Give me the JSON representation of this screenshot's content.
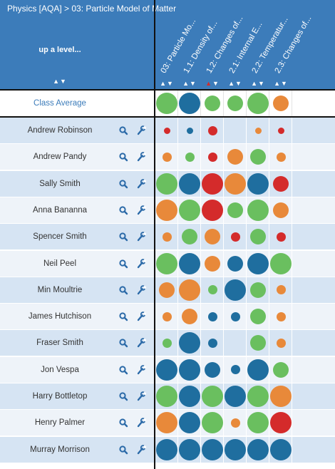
{
  "header": {
    "breadcrumb": "Physics [AQA] > 03: Particle Model of Matter",
    "up_level": "up a level...",
    "sort_icon": "▲▼"
  },
  "columns": [
    {
      "label": "03: Particle Mo...",
      "sort_active": false
    },
    {
      "label": "1.1: Density of...",
      "sort_active": false
    },
    {
      "label": "1.2: Changes of...",
      "sort_active": true
    },
    {
      "label": "2.1: Internal E...",
      "sort_active": false
    },
    {
      "label": "2.2: Temperatur...",
      "sort_active": false
    },
    {
      "label": "2.3: Changes of...",
      "sort_active": false
    }
  ],
  "colors": {
    "green": "#6abf5f",
    "blue": "#1f6e9f",
    "red": "#d42b2b",
    "orange": "#e8893a",
    "header_blue": "#3c7cba"
  },
  "icons": {
    "search": "search-icon",
    "wrench": "wrench-icon",
    "sort": "sort-arrows-icon"
  },
  "class_average": {
    "label": "Class Average",
    "cells": [
      {
        "color": "green",
        "size": 3
      },
      {
        "color": "blue",
        "size": 3
      },
      {
        "color": "green",
        "size": 2
      },
      {
        "color": "green",
        "size": 2
      },
      {
        "color": "green",
        "size": 3
      },
      {
        "color": "orange",
        "size": 2
      }
    ]
  },
  "students": [
    {
      "name": "Andrew Robinson",
      "cells": [
        {
          "color": "red",
          "size": 0
        },
        {
          "color": "blue",
          "size": 0
        },
        {
          "color": "red",
          "size": 1
        },
        null,
        {
          "color": "orange",
          "size": 0
        },
        {
          "color": "red",
          "size": 0
        }
      ]
    },
    {
      "name": "Andrew Pandy",
      "cells": [
        {
          "color": "orange",
          "size": 1
        },
        {
          "color": "green",
          "size": 1
        },
        {
          "color": "red",
          "size": 1
        },
        {
          "color": "orange",
          "size": 2
        },
        {
          "color": "green",
          "size": 2
        },
        {
          "color": "orange",
          "size": 1
        }
      ]
    },
    {
      "name": "Sally Smith",
      "cells": [
        {
          "color": "green",
          "size": 3
        },
        {
          "color": "blue",
          "size": 3
        },
        {
          "color": "red",
          "size": 3
        },
        {
          "color": "orange",
          "size": 3
        },
        {
          "color": "blue",
          "size": 3
        },
        {
          "color": "red",
          "size": 2
        }
      ]
    },
    {
      "name": "Anna Bananna",
      "cells": [
        {
          "color": "orange",
          "size": 3
        },
        {
          "color": "green",
          "size": 3
        },
        {
          "color": "red",
          "size": 3
        },
        {
          "color": "green",
          "size": 2
        },
        {
          "color": "green",
          "size": 3
        },
        {
          "color": "orange",
          "size": 2
        }
      ]
    },
    {
      "name": "Spencer Smith",
      "cells": [
        {
          "color": "orange",
          "size": 1
        },
        {
          "color": "green",
          "size": 2
        },
        {
          "color": "orange",
          "size": 2
        },
        {
          "color": "red",
          "size": 1
        },
        {
          "color": "green",
          "size": 2
        },
        {
          "color": "red",
          "size": 1
        }
      ]
    },
    {
      "name": "Neil Peel",
      "cells": [
        {
          "color": "green",
          "size": 3
        },
        {
          "color": "blue",
          "size": 3
        },
        {
          "color": "orange",
          "size": 2
        },
        {
          "color": "blue",
          "size": 2
        },
        {
          "color": "blue",
          "size": 3
        },
        {
          "color": "green",
          "size": 3
        }
      ]
    },
    {
      "name": "Min Moultrie",
      "cells": [
        {
          "color": "orange",
          "size": 2
        },
        {
          "color": "orange",
          "size": 3
        },
        {
          "color": "green",
          "size": 1
        },
        {
          "color": "blue",
          "size": 3
        },
        {
          "color": "green",
          "size": 2
        },
        {
          "color": "orange",
          "size": 1
        }
      ]
    },
    {
      "name": "James Hutchison",
      "cells": [
        {
          "color": "orange",
          "size": 1
        },
        {
          "color": "orange",
          "size": 2
        },
        {
          "color": "blue",
          "size": 1
        },
        {
          "color": "blue",
          "size": 1
        },
        {
          "color": "green",
          "size": 2
        },
        {
          "color": "orange",
          "size": 1
        }
      ]
    },
    {
      "name": "Fraser Smith",
      "cells": [
        {
          "color": "green",
          "size": 1
        },
        {
          "color": "blue",
          "size": 3
        },
        {
          "color": "blue",
          "size": 1
        },
        null,
        {
          "color": "green",
          "size": 2
        },
        {
          "color": "orange",
          "size": 1
        }
      ]
    },
    {
      "name": "Jon Vespa",
      "cells": [
        {
          "color": "blue",
          "size": 3
        },
        {
          "color": "blue",
          "size": 3
        },
        {
          "color": "blue",
          "size": 2
        },
        {
          "color": "blue",
          "size": 1
        },
        {
          "color": "blue",
          "size": 3
        },
        {
          "color": "green",
          "size": 2
        }
      ]
    },
    {
      "name": "Harry Bottletop",
      "cells": [
        {
          "color": "green",
          "size": 3
        },
        {
          "color": "blue",
          "size": 3
        },
        {
          "color": "green",
          "size": 3
        },
        {
          "color": "blue",
          "size": 3
        },
        {
          "color": "green",
          "size": 3
        },
        {
          "color": "orange",
          "size": 3
        }
      ]
    },
    {
      "name": "Henry Palmer",
      "cells": [
        {
          "color": "orange",
          "size": 3
        },
        {
          "color": "blue",
          "size": 3
        },
        {
          "color": "green",
          "size": 3
        },
        {
          "color": "orange",
          "size": 1
        },
        {
          "color": "green",
          "size": 3
        },
        {
          "color": "red",
          "size": 3
        }
      ]
    },
    {
      "name": "Murray Morrison",
      "cells": [
        {
          "color": "blue",
          "size": 3
        },
        {
          "color": "blue",
          "size": 3
        },
        {
          "color": "blue",
          "size": 3
        },
        {
          "color": "blue",
          "size": 3
        },
        {
          "color": "blue",
          "size": 3
        },
        {
          "color": "blue",
          "size": 3
        }
      ]
    }
  ]
}
